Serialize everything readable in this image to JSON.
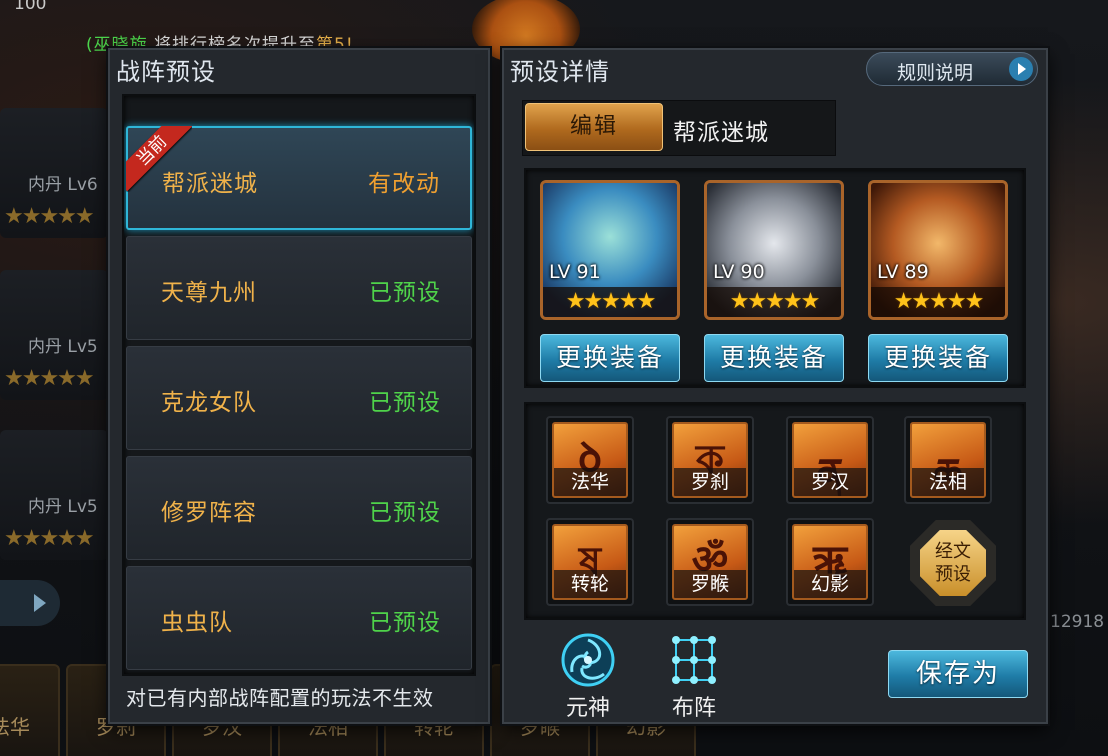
{
  "background": {
    "top_number": "100",
    "ticker": {
      "prefix": "(巫晓旋",
      "middle": "将排行榜名次提升至",
      "rank": "第5!"
    },
    "cards": [
      {
        "label": "内丹 Lv6"
      },
      {
        "label": "内丹 Lv5"
      },
      {
        "label": "内丹 Lv5"
      }
    ],
    "side_number": "12918",
    "bottom_tiles": [
      "法华",
      "罗刹",
      "罗汉",
      "法相",
      "转轮",
      "罗睺",
      "幻影"
    ]
  },
  "left_panel": {
    "title": "战阵预设",
    "presets": [
      {
        "name": "帮派迷城",
        "status": "有改动",
        "current_badge": "当前"
      },
      {
        "name": "天尊九州",
        "status": "已预设"
      },
      {
        "name": "克龙女队",
        "status": "已预设"
      },
      {
        "name": "修罗阵容",
        "status": "已预设"
      },
      {
        "name": "虫虫队",
        "status": "已预设"
      }
    ],
    "footer": "对已有内部战阵配置的玩法不生效"
  },
  "right_panel": {
    "title": "预设详情",
    "rules_button": "规则说明",
    "edit_button": "编辑",
    "preset_name": "帮派迷城",
    "heroes": [
      {
        "level": "LV 91",
        "stars": "★★★★★",
        "equip_button": "更换装备",
        "colors": [
          "#3a7cc0",
          "#7ad0c0"
        ]
      },
      {
        "level": "LV 90",
        "stars": "★★★★★",
        "equip_button": "更换装备",
        "colors": [
          "#6a7280",
          "#c9ced6"
        ]
      },
      {
        "level": "LV 89",
        "stars": "★★★★★",
        "equip_button": "更换装备",
        "colors": [
          "#8a3a18",
          "#e89a3a"
        ]
      }
    ],
    "scripts": [
      {
        "label": "法华",
        "glyph": "ꝺ"
      },
      {
        "label": "罗刹",
        "glyph": "ক"
      },
      {
        "label": "罗汉",
        "glyph": "ན"
      },
      {
        "label": "法相",
        "glyph": "ཆ"
      },
      {
        "label": "转轮",
        "glyph": "ষ"
      },
      {
        "label": "罗睺",
        "glyph": "ॐ"
      },
      {
        "label": "幻影",
        "glyph": "ॠ"
      }
    ],
    "scripts_preset_button": {
      "line1": "经文",
      "line2": "预设"
    },
    "bottom_icons": [
      {
        "label": "元神",
        "icon": "spirit-swirl-icon"
      },
      {
        "label": "布阵",
        "icon": "formation-grid-icon"
      }
    ],
    "save_button": "保存为"
  },
  "colors": {
    "accent_blue": "#2fb6d8",
    "orange_status": "#f0a030",
    "green_status": "#4fd34a",
    "name_gold": "#f0b24a",
    "badge_red": "#c4281e"
  }
}
